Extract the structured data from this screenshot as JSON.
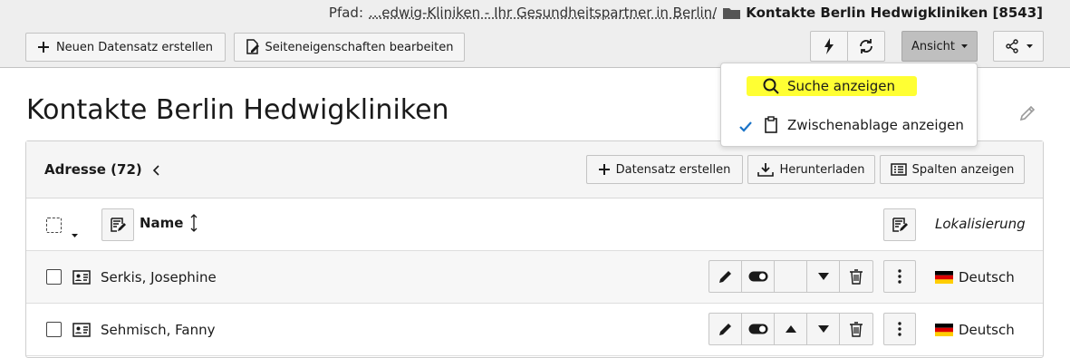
{
  "header": {
    "path_label": "Pfad:",
    "path_link": "...edwig-Kliniken - Ihr Gesundheitspartner in Berlin/",
    "path_current": "Kontakte Berlin Hedwigkliniken [8543]",
    "new_record_button": "Neuen Datensatz erstellen",
    "edit_page_button": "Seiteneigenschaften bearbeiten",
    "view_button": "Ansicht"
  },
  "view_menu": {
    "items": [
      {
        "label": "Suche anzeigen",
        "highlighted": true,
        "checked": false
      },
      {
        "label": "Zwischenablage anzeigen",
        "highlighted": false,
        "checked": true
      }
    ],
    "highlight_color": "#ffff33",
    "check_color": "#1a73c7"
  },
  "page": {
    "title": "Kontakte Berlin Hedwigkliniken"
  },
  "table": {
    "heading": "Adresse (72)",
    "actions": {
      "create": "Datensatz erstellen",
      "download": "Herunterladen",
      "columns": "Spalten anzeigen"
    },
    "columns": {
      "name": "Name",
      "localization": "Lokalisierung"
    },
    "rows": [
      {
        "name": "Serkis, Josephine",
        "language": "Deutsch"
      },
      {
        "name": "Sehmisch, Fanny",
        "language": "Deutsch"
      }
    ]
  }
}
